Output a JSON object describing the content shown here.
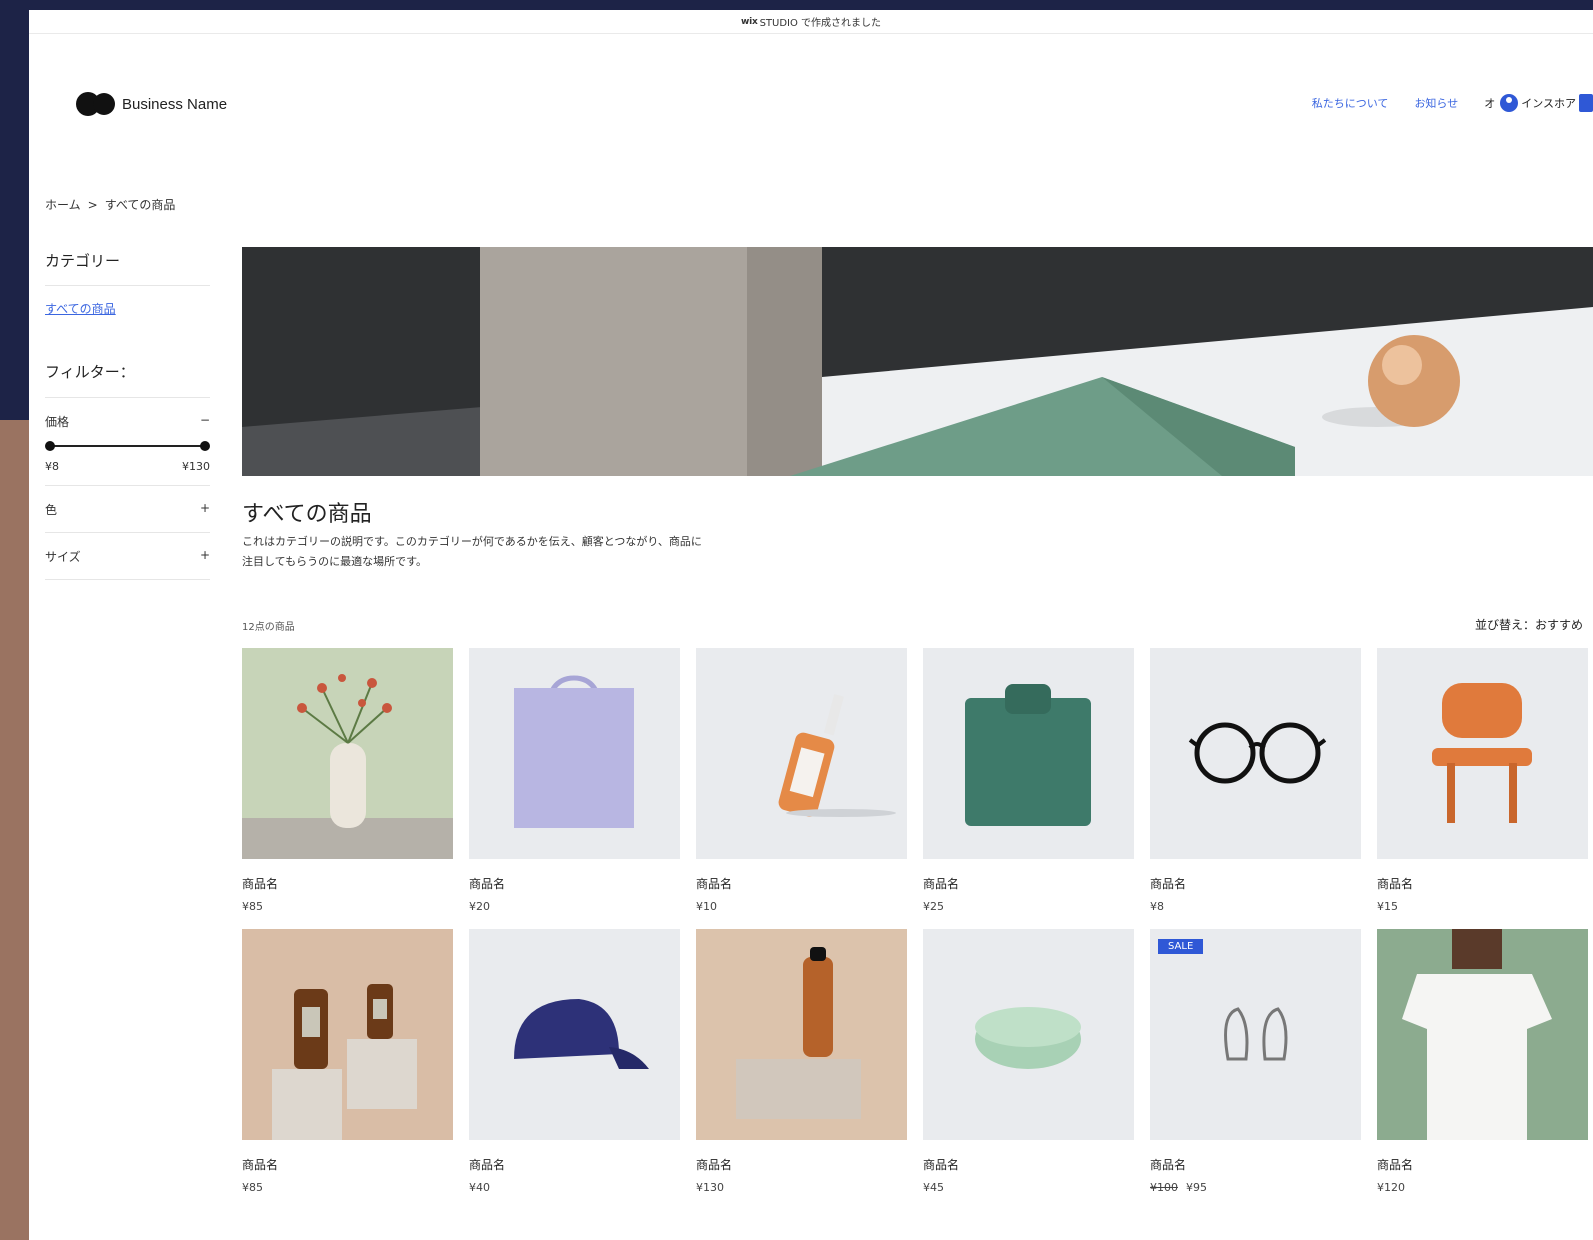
{
  "wixbar": {
    "brand": "wix",
    "suffix": "STUDIO で作成されました"
  },
  "header": {
    "logo_text": "Business Name",
    "nav": [
      "私たちについて",
      "お知らせ"
    ],
    "account_prefix": "オ",
    "account_label": "インスホア"
  },
  "breadcrumb": {
    "home": "ホーム",
    "sep": ">",
    "current": "すべての商品"
  },
  "sidebar": {
    "category_title": "カテゴリー",
    "category_link": "すべての商品",
    "filter_title": "フィルター：",
    "price_label": "価格",
    "price_toggle": "−",
    "price_min": "¥8",
    "price_max": "¥130",
    "color_label": "色",
    "color_toggle": "+",
    "size_label": "サイズ",
    "size_toggle": "+"
  },
  "category": {
    "title": "すべての商品",
    "desc_line1": "これはカテゴリーの説明です。このカテゴリーが何であるかを伝え、顧客とつながり、商品に",
    "desc_line2": "注目してもらうのに最適な場所です。"
  },
  "list": {
    "count": "12点の商品",
    "sort": "並び替え：おすすめ"
  },
  "products": [
    {
      "name": "商品名",
      "price": "¥85"
    },
    {
      "name": "商品名",
      "price": "¥20"
    },
    {
      "name": "商品名",
      "price": "¥10"
    },
    {
      "name": "商品名",
      "price": "¥25"
    },
    {
      "name": "商品名",
      "price": "¥8"
    },
    {
      "name": "商品名",
      "price": "¥15"
    },
    {
      "name": "商品名",
      "price": "¥85"
    },
    {
      "name": "商品名",
      "price": "¥40"
    },
    {
      "name": "商品名",
      "price": "¥130"
    },
    {
      "name": "商品名",
      "price": "¥45"
    },
    {
      "name": "商品名",
      "old_price": "¥100",
      "price": "¥95",
      "badge": "SALE"
    },
    {
      "name": "商品名",
      "price": "¥120"
    }
  ],
  "colors": {
    "accent": "#2f58d6",
    "link": "#3b66e0",
    "frame_top": "#1d2347",
    "frame_bottom": "#9a7361"
  }
}
